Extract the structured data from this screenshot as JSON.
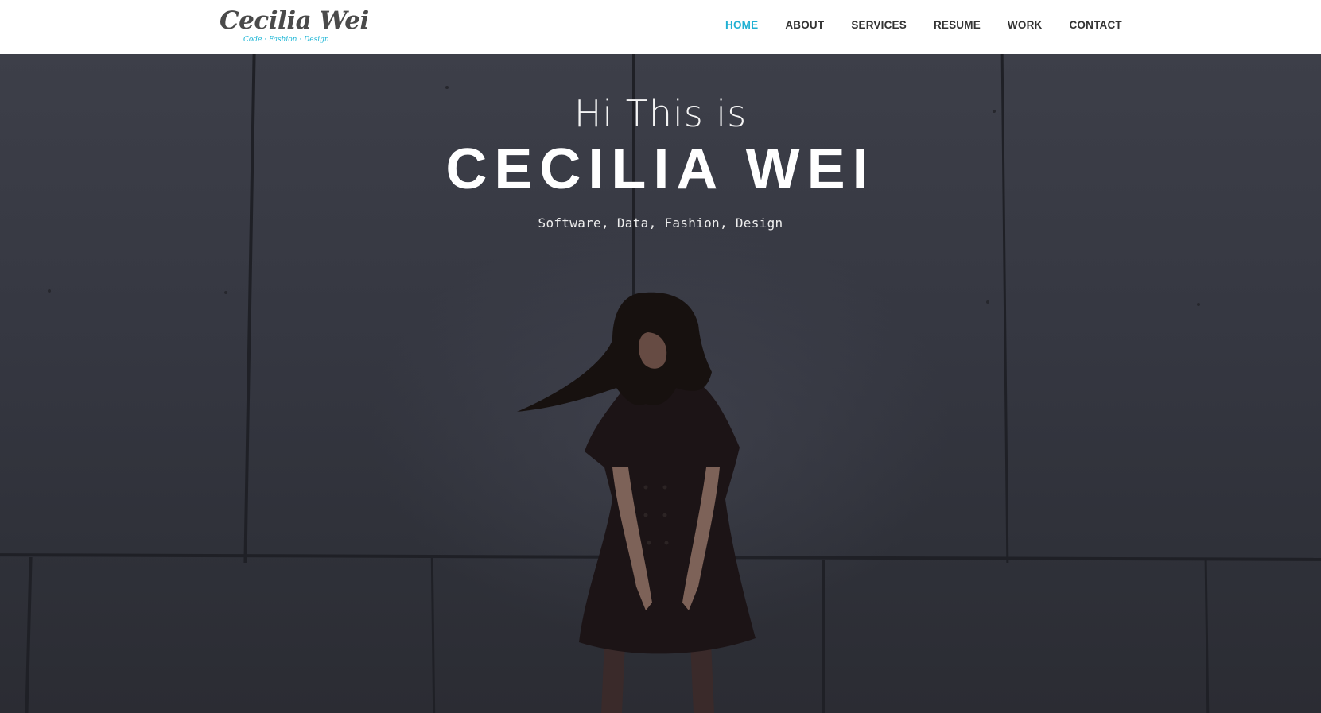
{
  "logo": {
    "name": "Cecilia Wei",
    "tagline": "Code · Fashion · Design"
  },
  "nav": {
    "items": [
      {
        "label": "HOME",
        "active": true
      },
      {
        "label": "ABOUT",
        "active": false
      },
      {
        "label": "SERVICES",
        "active": false
      },
      {
        "label": "RESUME",
        "active": false
      },
      {
        "label": "WORK",
        "active": false
      },
      {
        "label": "CONTACT",
        "active": false
      }
    ]
  },
  "hero": {
    "greeting": "Hi This is",
    "name": "CECILIA WEI",
    "subtitle": "Software, Data, Fashion, Design"
  },
  "colors": {
    "accent": "#1fb0d3",
    "nav_text": "#333333",
    "hero_bg": "#353741"
  }
}
